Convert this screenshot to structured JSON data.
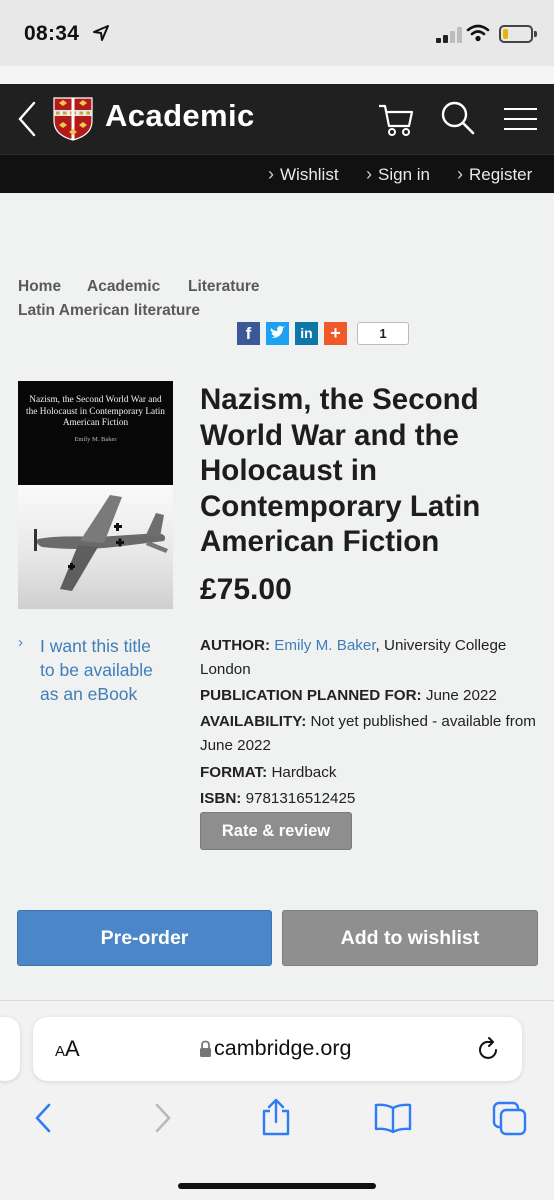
{
  "status_bar": {
    "time": "08:34"
  },
  "header": {
    "brand": "Academic",
    "links": [
      {
        "label": "Wishlist"
      },
      {
        "label": "Sign in"
      },
      {
        "label": "Register"
      }
    ]
  },
  "breadcrumb": [
    "Home",
    "Academic",
    "Literature",
    "Latin American literature"
  ],
  "share": {
    "count": "1"
  },
  "book": {
    "cover_title": "Nazism, the Second World War and the Holocaust in Contemporary Latin American Fiction",
    "cover_author": "Emily M. Baker",
    "title": "Nazism, the Second World War and the Holocaust in Contemporary Latin American Fiction",
    "price": "£75.00",
    "ebook_link": "I want this title to be available as an eBook",
    "author_label": "AUTHOR:",
    "author_name": "Emily M. Baker",
    "author_affiliation": ", University College London",
    "pub_label": "PUBLICATION PLANNED FOR:",
    "pub_value": "June 2022",
    "availability_label": "AVAILABILITY:",
    "availability_value": "Not yet published - available from June 2022",
    "format_label": "FORMAT:",
    "format_value": "Hardback",
    "isbn_label": "ISBN:",
    "isbn_value": "9781316512425"
  },
  "buttons": {
    "rate": "Rate & review",
    "preorder": "Pre-order",
    "wishlist": "Add to wishlist"
  },
  "browser": {
    "aa_label_small": "A",
    "aa_label_big": "A",
    "domain": "cambridge.org"
  },
  "colors": {
    "header_bg": "#202020",
    "accent_blue": "#4a86c8",
    "button_grey": "#8f8f8f",
    "link_blue": "#3f7eb9"
  }
}
